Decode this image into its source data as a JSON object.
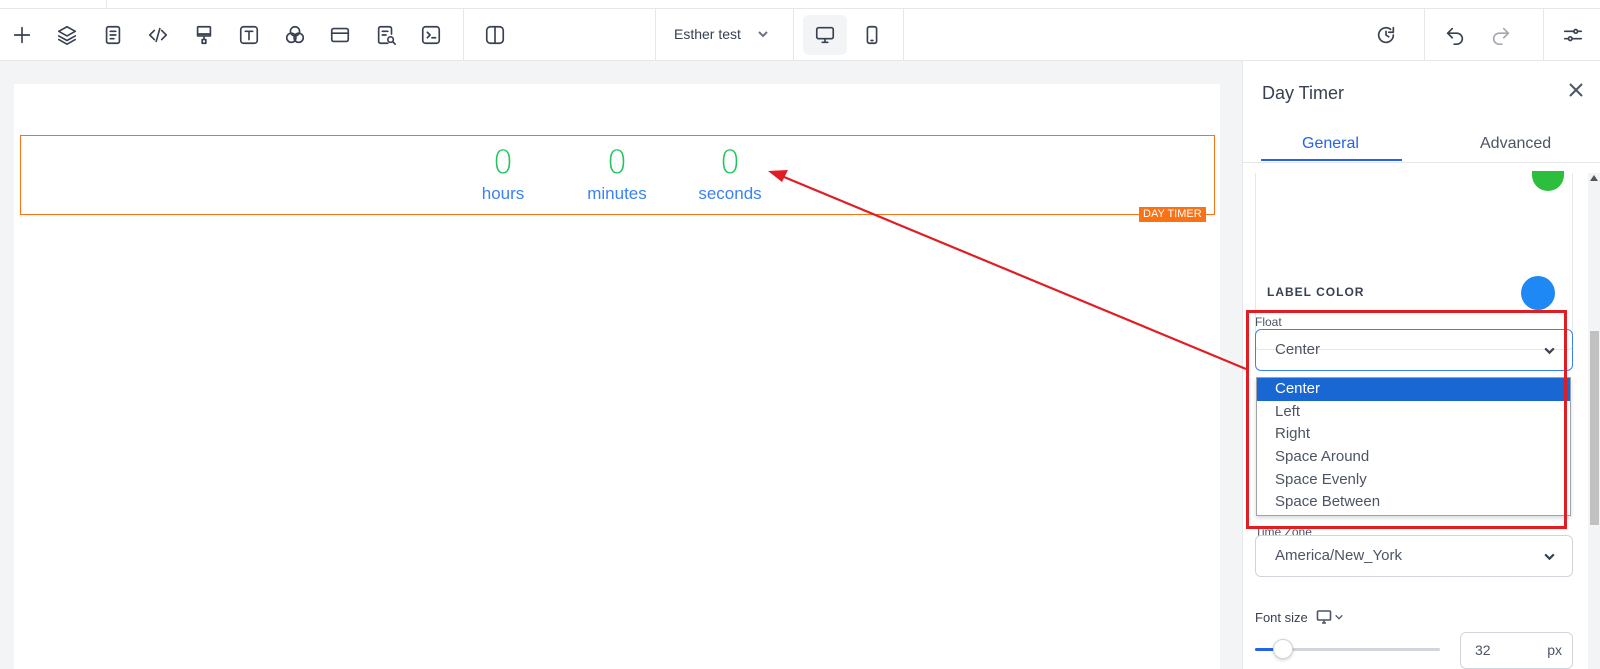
{
  "toolbar": {
    "page_name": "Esther test",
    "icons": [
      "plus-icon",
      "layers-icon",
      "page-icon",
      "code-icon",
      "paint-icon",
      "text-icon",
      "circles-icon",
      "window-icon",
      "search-doc-icon",
      "terminal-icon",
      "split-icon",
      "desktop-icon",
      "mobile-icon",
      "history-icon",
      "undo-icon",
      "redo-icon",
      "settings-icon"
    ]
  },
  "canvas": {
    "timer": {
      "hours_value": "0",
      "minutes_value": "0",
      "seconds_value": "0",
      "hours_label": "hours",
      "minutes_label": "minutes",
      "seconds_label": "seconds",
      "badge": "DAY TIMER"
    }
  },
  "panel": {
    "title": "Day Timer",
    "tabs": [
      "General",
      "Advanced"
    ],
    "active_tab": "General",
    "label_color_text": "LABEL COLOR",
    "label_color": "#1e88f5",
    "value_color": "#2dbe3d",
    "float": {
      "label": "Float",
      "value": "Center",
      "options": [
        "Center",
        "Left",
        "Right",
        "Space Around",
        "Space Evenly",
        "Space Between"
      ]
    },
    "time_zone": {
      "label": "Time Zone",
      "value": "America/New_York"
    },
    "font_size": {
      "label": "Font size",
      "value": "32",
      "unit": "px",
      "slider_fraction": 0.1
    }
  },
  "colors": {
    "accent": "#2563eb",
    "timer_border": "#f97316",
    "annotation": "#e11d24"
  }
}
